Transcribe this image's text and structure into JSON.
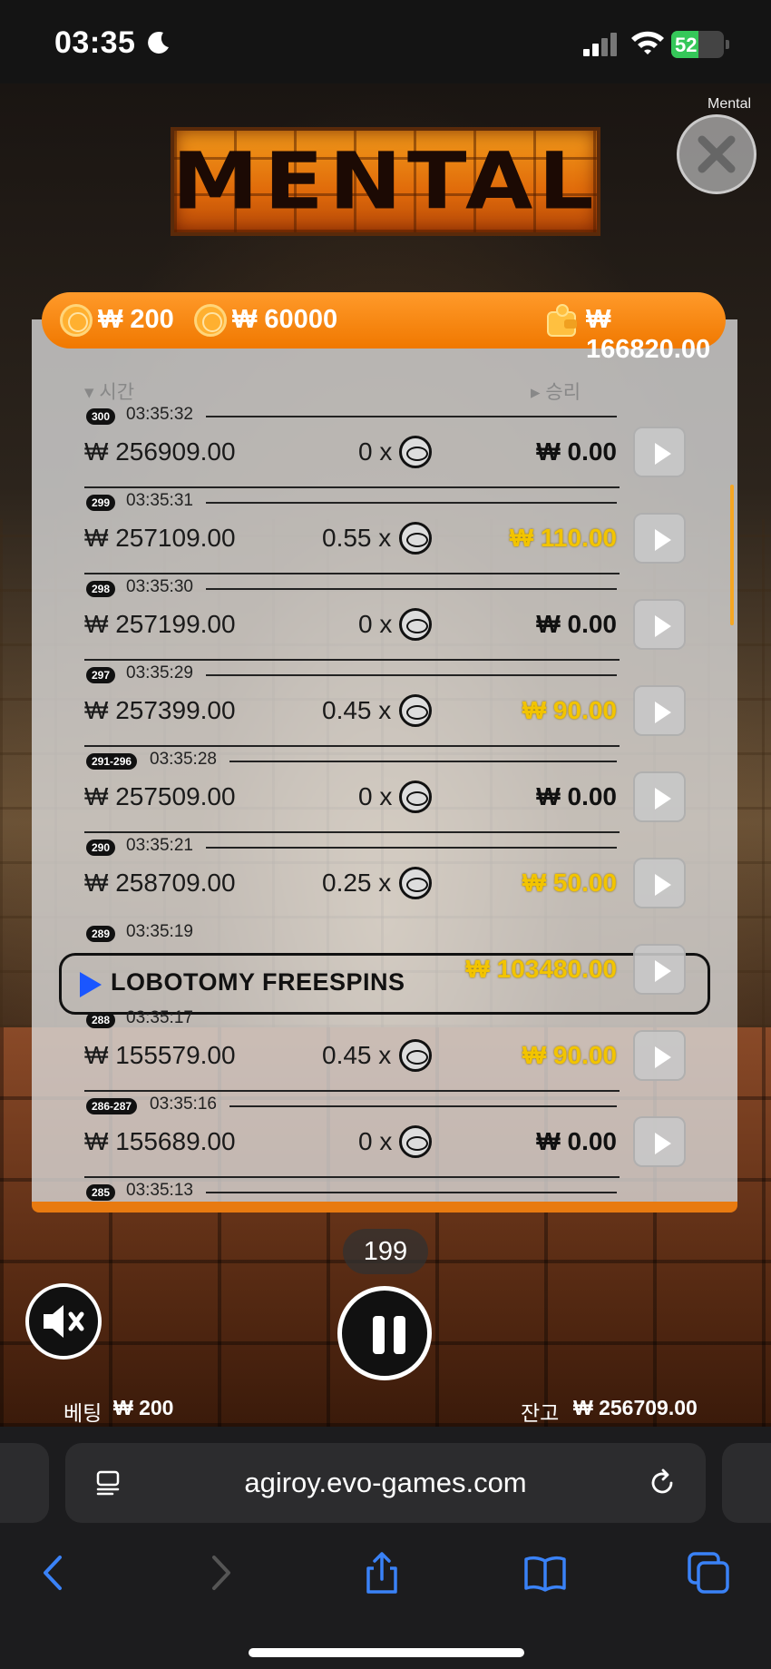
{
  "status_bar": {
    "time": "03:35",
    "battery": "52"
  },
  "game": {
    "logo_text": "MENTAL",
    "close_label": "Mental",
    "top_bar": {
      "bet_min": "₩ 200",
      "bet_max": "₩ 60000",
      "wallet": "₩ 166820.00"
    },
    "headers": {
      "time": "시간",
      "win": "승리"
    },
    "rows": [
      {
        "badge": "300",
        "time": "03:35:32",
        "amount": "₩ 256909.00",
        "mult": "0 x",
        "win": "₩ 0.00",
        "gold": false
      },
      {
        "badge": "299",
        "time": "03:35:31",
        "amount": "₩ 257109.00",
        "mult": "0.55 x",
        "win": "₩ 110.00",
        "gold": true
      },
      {
        "badge": "298",
        "time": "03:35:30",
        "amount": "₩ 257199.00",
        "mult": "0 x",
        "win": "₩ 0.00",
        "gold": false
      },
      {
        "badge": "297",
        "time": "03:35:29",
        "amount": "₩ 257399.00",
        "mult": "0.45 x",
        "win": "₩ 90.00",
        "gold": true
      },
      {
        "badge": "291-296",
        "time": "03:35:28",
        "amount": "₩ 257509.00",
        "mult": "0 x",
        "win": "₩ 0.00",
        "gold": false
      },
      {
        "badge": "290",
        "time": "03:35:21",
        "amount": "₩ 258709.00",
        "mult": "0.25 x",
        "win": "₩ 50.00",
        "gold": true
      }
    ],
    "freespins": {
      "badge": "289",
      "time": "03:35:19",
      "label": "LOBOTOMY FREESPINS",
      "win": "₩ 103480.00"
    },
    "rows2": [
      {
        "badge": "288",
        "time": "03:35:17",
        "amount": "₩ 155579.00",
        "mult": "0.45 x",
        "win": "₩ 90.00",
        "gold": true
      },
      {
        "badge": "286-287",
        "time": "03:35:16",
        "amount": "₩ 155689.00",
        "mult": "0 x",
        "win": "₩ 0.00",
        "gold": false
      }
    ],
    "partial_row": {
      "badge": "285",
      "time": "03:35:13"
    },
    "spin_count": "199",
    "bet_label": "베팅",
    "bet_value": "₩ 200",
    "balance_label": "잔고",
    "balance_value": "₩ 256709.00"
  },
  "browser": {
    "url": "agiroy.evo-games.com"
  },
  "colors": {
    "accent": "#f07800",
    "gold": "#f2c400",
    "freespin_arrow": "#1a56ff"
  }
}
